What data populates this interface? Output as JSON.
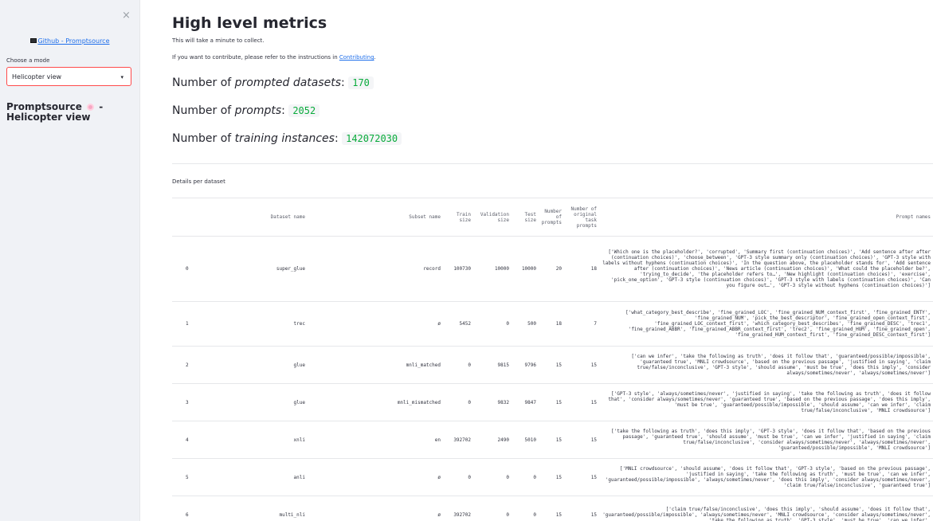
{
  "sidebar": {
    "close_icon": "×",
    "github_link": "Github - Promptsource",
    "mode_label": "Choose a mode",
    "mode_value": "Helicopter view",
    "chevron": "▾",
    "title_part1": "Promptsource",
    "title_part2": "- Helicopter view"
  },
  "main": {
    "title": "High level metrics",
    "note1": "This will take a minute to collect.",
    "note2_prefix": "If you want to contribute, please refer to the instructions in ",
    "note2_link": "Contributing",
    "note2_suffix": ".",
    "metrics": [
      {
        "label_prefix": "Number of ",
        "label_em": "prompted datasets",
        "label_suffix": ": ",
        "value": "170"
      },
      {
        "label_prefix": "Number of ",
        "label_em": "prompts",
        "label_suffix": ": ",
        "value": "2052"
      },
      {
        "label_prefix": "Number of ",
        "label_em": "training instances",
        "label_suffix": ": ",
        "value": "142072030"
      }
    ],
    "details_label": "Details per dataset"
  },
  "table": {
    "headers": [
      "",
      "Dataset name",
      "Subset name",
      "Train size",
      "Validation size",
      "Test size",
      "Number of prompts",
      "Number of original task prompts",
      "Prompt names"
    ],
    "rows": [
      [
        "0",
        "super_glue",
        "record",
        "100730",
        "10000",
        "10000",
        "20",
        "18",
        "['Which one is the placeholder?', 'corrupted', 'Summary first (continuation choices)', 'Add sentence after after (continuation choices)', 'choose_between', 'GPT-3 style summary only (continuation choices)', 'GPT-3 style with labels without hyphens (continuation choices)', 'In the question above, the placeholder stands for', 'Add sentence after (continuation choices)', 'News article (continuation choices)', 'What could the placeholder be?', 'trying_to_decide', 'the placeholder refers to…', 'New highlight (continuation choices)', 'exercise', 'pick_one_option', 'GPT-3 style (continuation choices)', 'GPT-3 style with labels (continuation choices)', 'Can you figure out…', 'GPT-3 style without hyphens (continuation choices)']"
      ],
      [
        "1",
        "trec",
        "ø",
        "5452",
        "0",
        "500",
        "18",
        "7",
        "['what_category_best_describe', 'fine_grained_LOC', 'fine_grained_NUM_context_first', 'fine_grained_ENTY', 'fine_grained_NUM', 'pick_the_best_descriptor', 'fine_grained_open_context_first', 'fine_grained_LOC_context_first', 'which_category_best_describes', 'fine_grained_DESC', 'trec1', 'fine_grained_ABBR', 'fine_grained_ABBR_context_first', 'trec2', 'fine_grained_HUM', 'fine_grained_open', 'fine_grained_HUM_context_first', 'fine_grained_DESC_context_first']"
      ],
      [
        "2",
        "glue",
        "mnli_matched",
        "0",
        "9815",
        "9796",
        "15",
        "15",
        "['can we infer', 'take the following as truth', 'does it follow that', 'guaranteed/possible/impossible', 'guaranteed true', 'MNLI crowdsource', 'based on the previous passage', 'justified in saying', 'claim true/false/inconclusive', 'GPT-3 style', 'should assume', 'must be true', 'does this imply', 'consider always/sometimes/never', 'always/sometimes/never']"
      ],
      [
        "3",
        "glue",
        "mnli_mismatched",
        "0",
        "9832",
        "9847",
        "15",
        "15",
        "['GPT-3 style', 'always/sometimes/never', 'justified in saying', 'take the following as truth', 'does it follow that', 'consider always/sometimes/never', 'guaranteed true', 'based on the previous passage', 'does this imply', 'must be true', 'guaranteed/possible/impossible', 'should assume', 'can we infer', 'claim true/false/inconclusive', 'MNLI crowdsource']"
      ],
      [
        "4",
        "xnli",
        "en",
        "392702",
        "2490",
        "5010",
        "15",
        "15",
        "['take the following as truth', 'does this imply', 'GPT-3 style', 'does it follow that', 'based on the previous passage', 'guaranteed true', 'should assume', 'must be true', 'can we infer', 'justified in saying', 'claim true/false/inconclusive', 'consider always/sometimes/never', 'always/sometimes/never', 'guaranteed/possible/impossible', 'MNLI crowdsource']"
      ],
      [
        "5",
        "anli",
        "ø",
        "0",
        "0",
        "0",
        "15",
        "15",
        "['MNLI crowdsource', 'should assume', 'does it follow that', 'GPT-3 style', 'based on the previous passage', 'justified in saying', 'take the following as truth', 'must be true', 'can we infer', 'guaranteed/possible/impossible', 'always/sometimes/never', 'does this imply', 'consider always/sometimes/never', 'claim true/false/inconclusive', 'guaranteed true']"
      ],
      [
        "6",
        "multi_nli",
        "ø",
        "392702",
        "0",
        "0",
        "15",
        "15",
        "['claim true/false/inconclusive', 'does this imply', 'should assume', 'does it follow that', 'guaranteed/possible/impossible', 'always/sometimes/never', 'MNLI crowdsource', 'consider always/sometimes/never', 'take the following as truth', 'GPT-3 style', 'must be true', 'can we infer',"
      ]
    ]
  }
}
